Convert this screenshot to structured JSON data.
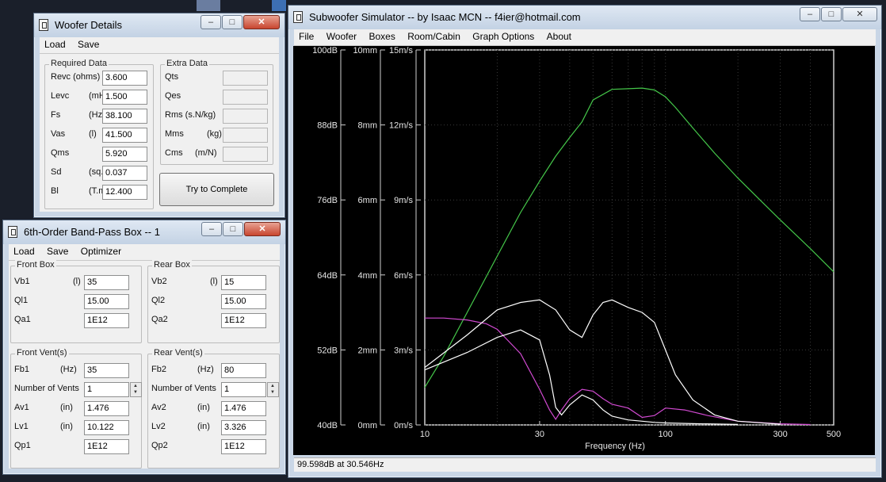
{
  "woofer_window": {
    "title": "Woofer Details",
    "menu": [
      "Load",
      "Save"
    ],
    "required_group": "Required Data",
    "extra_group": "Extra Data",
    "required_fields": [
      {
        "label": "Revc (ohms)",
        "unit": "",
        "value": "3.600"
      },
      {
        "label": "Levc",
        "unit": "(mH)",
        "value": "1.500"
      },
      {
        "label": "Fs",
        "unit": "(Hz)",
        "value": "38.100"
      },
      {
        "label": "Vas",
        "unit": "(l)",
        "value": "41.500"
      },
      {
        "label": "Qms",
        "unit": "",
        "value": "5.920"
      },
      {
        "label": "Sd",
        "unit": "(sq.m)",
        "value": "0.037"
      },
      {
        "label": "Bl",
        "unit": "(T.m)",
        "value": "12.400"
      }
    ],
    "extra_fields": [
      {
        "label": "Qts",
        "unit": "",
        "value": ""
      },
      {
        "label": "Qes",
        "unit": "",
        "value": ""
      },
      {
        "label": "Rms (s.N/kg)",
        "unit": "",
        "value": ""
      },
      {
        "label": "Mms",
        "unit": "(kg)",
        "value": ""
      },
      {
        "label": "Cms",
        "unit": "(m/N)",
        "value": ""
      }
    ],
    "button": "Try to Complete"
  },
  "box_window": {
    "title": "6th-Order Band-Pass Box -- 1",
    "menu": [
      "Load",
      "Save",
      "Optimizer"
    ],
    "front_box": {
      "title": "Front Box",
      "fields": [
        {
          "label": "Vb1",
          "unit": "(l)",
          "value": "35"
        },
        {
          "label": "Ql1",
          "unit": "",
          "value": "15.00"
        },
        {
          "label": "Qa1",
          "unit": "",
          "value": "1E12"
        }
      ]
    },
    "rear_box": {
      "title": "Rear Box",
      "fields": [
        {
          "label": "Vb2",
          "unit": "(l)",
          "value": "15"
        },
        {
          "label": "Ql2",
          "unit": "",
          "value": "15.00"
        },
        {
          "label": "Qa2",
          "unit": "",
          "value": "1E12"
        }
      ]
    },
    "front_vent": {
      "title": "Front Vent(s)",
      "fields": [
        {
          "label": "Fb1",
          "unit": "(Hz)",
          "value": "35"
        },
        {
          "label": "Number of Vents",
          "unit": "",
          "value": "1"
        },
        {
          "label": "Av1",
          "unit": "(in)",
          "value": "1.476"
        },
        {
          "label": "Lv1",
          "unit": "(in)",
          "value": "10.122"
        },
        {
          "label": "Qp1",
          "unit": "",
          "value": "1E12"
        }
      ]
    },
    "rear_vent": {
      "title": "Rear Vent(s)",
      "fields": [
        {
          "label": "Fb2",
          "unit": "(Hz)",
          "value": "80"
        },
        {
          "label": "Number of Vents",
          "unit": "",
          "value": "1"
        },
        {
          "label": "Av2",
          "unit": "(in)",
          "value": "1.476"
        },
        {
          "label": "Lv2",
          "unit": "(in)",
          "value": "3.326"
        },
        {
          "label": "Qp2",
          "unit": "",
          "value": "1E12"
        }
      ]
    }
  },
  "sim_window": {
    "title": "Subwoofer Simulator -- by Isaac MCN -- f4ier@hotmail.com",
    "menu": [
      "File",
      "Woofer",
      "Boxes",
      "Room/Cabin",
      "Graph Options",
      "About"
    ],
    "status": "99.598dB at 30.546Hz"
  },
  "chart_data": {
    "type": "line",
    "xlabel": "Frequency (Hz)",
    "x_scale": "log",
    "xlim": [
      10,
      500
    ],
    "x_ticks": [
      10,
      30,
      100,
      300,
      500
    ],
    "axes": [
      {
        "unit": "dB",
        "range": [
          40,
          100
        ],
        "ticks": [
          "100dB",
          "88dB",
          "76dB",
          "64dB",
          "52dB",
          "40dB"
        ]
      },
      {
        "unit": "mm",
        "range": [
          0,
          10
        ],
        "ticks": [
          "10mm",
          "8mm",
          "6mm",
          "4mm",
          "2mm",
          "0mm"
        ]
      },
      {
        "unit": "m/s",
        "range": [
          0,
          15
        ],
        "ticks": [
          "15m/s",
          "12m/s",
          "9m/s",
          "6m/s",
          "3m/s",
          "0m/s"
        ]
      }
    ],
    "grid": true,
    "colors": {
      "spl": "#45c84a",
      "excursion": "#d24ad2",
      "vent_front": "#ffffff",
      "vent_rear": "#ffffff"
    },
    "series": [
      {
        "key": "spl",
        "axis": "dB",
        "x": [
          10,
          12,
          15,
          20,
          25,
          30,
          35,
          40,
          45,
          50,
          60,
          70,
          80,
          90,
          100,
          110,
          130,
          160,
          200,
          250,
          300,
          400,
          500
        ],
        "y": [
          46,
          51,
          58,
          67,
          74,
          79,
          83,
          86,
          88.5,
          92,
          93.7,
          93.8,
          93.9,
          93.6,
          92.5,
          90.8,
          87.5,
          83.5,
          79.5,
          75.8,
          72.8,
          68.2,
          64.5
        ]
      },
      {
        "key": "excursion",
        "axis": "mm",
        "x": [
          10,
          12,
          15,
          18,
          20,
          25,
          30,
          33,
          35,
          37,
          40,
          45,
          50,
          55,
          60,
          70,
          80,
          90,
          100,
          120,
          150,
          200,
          300,
          400
        ],
        "y": [
          2.85,
          2.85,
          2.8,
          2.7,
          2.55,
          1.9,
          0.95,
          0.4,
          0.15,
          0.4,
          0.7,
          0.95,
          0.9,
          0.7,
          0.55,
          0.45,
          0.2,
          0.25,
          0.45,
          0.4,
          0.25,
          0.1,
          0.03,
          0.01
        ]
      },
      {
        "key": "vent_front",
        "axis": "m/s",
        "x": [
          10,
          15,
          20,
          25,
          30,
          33,
          35,
          37,
          40,
          45,
          50,
          55,
          60,
          70,
          80,
          90,
          100,
          130,
          200
        ],
        "y": [
          2.2,
          2.9,
          3.5,
          3.8,
          3.4,
          2.0,
          0.7,
          0.4,
          0.8,
          1.2,
          1.0,
          0.6,
          0.35,
          0.2,
          0.15,
          0.1,
          0.08,
          0.05,
          0.02
        ]
      },
      {
        "key": "vent_rear",
        "axis": "m/s",
        "x": [
          10,
          15,
          20,
          25,
          30,
          35,
          40,
          45,
          50,
          55,
          60,
          70,
          80,
          90,
          100,
          110,
          130,
          160,
          200,
          300
        ],
        "y": [
          2.3,
          3.6,
          4.6,
          4.9,
          5.0,
          4.6,
          3.8,
          3.5,
          4.4,
          4.9,
          5.0,
          4.7,
          4.5,
          4.1,
          3.0,
          2.0,
          1.0,
          0.4,
          0.15,
          0.03
        ]
      }
    ]
  }
}
